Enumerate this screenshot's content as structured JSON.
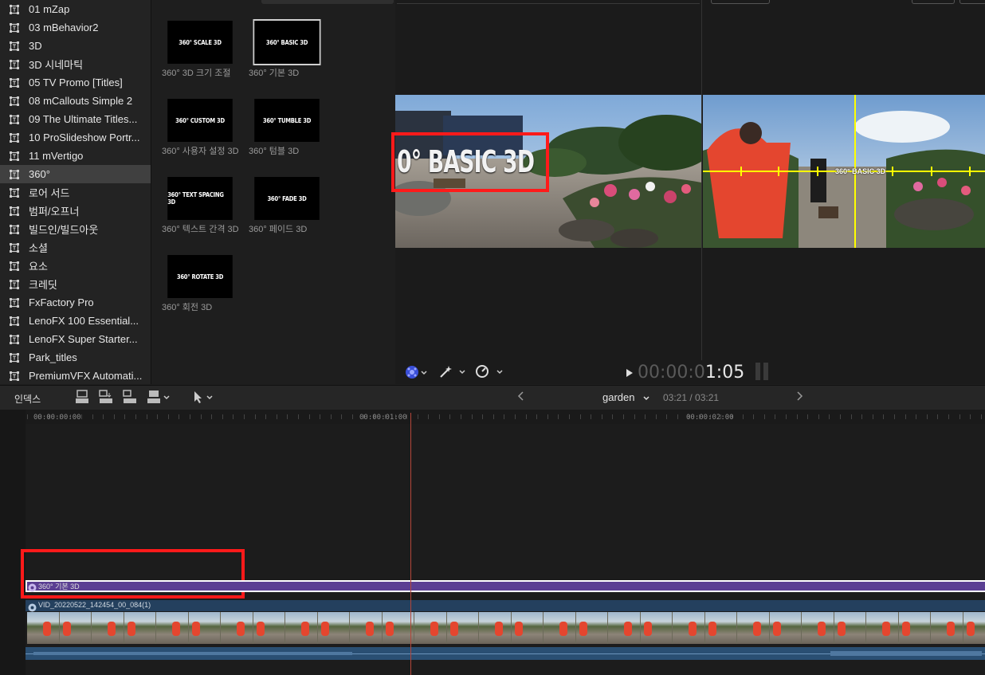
{
  "sidebar": {
    "items": [
      {
        "label": "01 mZap",
        "selected": false
      },
      {
        "label": "03 mBehavior2",
        "selected": false
      },
      {
        "label": "3D",
        "selected": false
      },
      {
        "label": "3D 시네마틱",
        "selected": false
      },
      {
        "label": "05 TV Promo [Titles]",
        "selected": false
      },
      {
        "label": "08 mCallouts Simple 2",
        "selected": false
      },
      {
        "label": "09 The Ultimate Titles...",
        "selected": false
      },
      {
        "label": "10 ProSlideshow Portr...",
        "selected": false
      },
      {
        "label": "11 mVertigo",
        "selected": false
      },
      {
        "label": "360°",
        "selected": true
      },
      {
        "label": "로어 서드",
        "selected": false
      },
      {
        "label": "범퍼/오프너",
        "selected": false
      },
      {
        "label": "빌드인/빌드아웃",
        "selected": false
      },
      {
        "label": "소셜",
        "selected": false
      },
      {
        "label": "요소",
        "selected": false
      },
      {
        "label": "크레딧",
        "selected": false
      },
      {
        "label": "FxFactory Pro",
        "selected": false
      },
      {
        "label": "LenoFX 100 Essential...",
        "selected": false
      },
      {
        "label": "LenoFX Super Starter...",
        "selected": false
      },
      {
        "label": "Park_titles",
        "selected": false
      },
      {
        "label": "PremiumVFX Automati...",
        "selected": false
      }
    ]
  },
  "browser": {
    "thumbs": [
      {
        "thumb_text": "360° SCALE 3D",
        "label": "360° 3D 크기 조절",
        "selected": false
      },
      {
        "thumb_text": "360° BASIC 3D",
        "label": "360° 기본 3D",
        "selected": true
      },
      {
        "thumb_text": "360° CUSTOM 3D",
        "label": "360° 사용자 설정 3D",
        "selected": false
      },
      {
        "thumb_text": "360° TUMBLE 3D",
        "label": "360° 텀블 3D",
        "selected": false
      },
      {
        "thumb_text": "360° TEXT SPACING 3D",
        "label": "360° 텍스트 간격 3D",
        "selected": false
      },
      {
        "thumb_text": "360° FADE 3D",
        "label": "360° 페이드 3D",
        "selected": false
      },
      {
        "thumb_text": "360° ROTATE 3D",
        "label": "360° 회전 3D",
        "selected": false
      }
    ]
  },
  "viewer": {
    "left_title_text": "0° BASIC 3D",
    "right_title_text": "360° BASIC 3D",
    "timecode_dim": "00:00:0",
    "timecode_bright": "1:05"
  },
  "timeline_header": {
    "index_label": "인덱스",
    "project_name": "garden",
    "duration": "03:21 / 03:21"
  },
  "ruler": {
    "labels": [
      "00:00:00:00",
      "00:00:01:00",
      "00:00:02:00"
    ]
  },
  "clips": {
    "title_clip": "360° 기본 3D",
    "video_clip": "VID_20220522_142454_00_084(1)"
  },
  "colors": {
    "accent_purple": "#5b3f93",
    "video_blue": "#24405e",
    "highlight_red": "#ff1a1a",
    "guide_yellow": "#ffff00"
  },
  "icons": {
    "sidebar_item": "title-generator-icon",
    "effects": "effects-icon",
    "magic": "magic-wand-icon",
    "speed": "retime-icon",
    "play": "play-icon"
  }
}
